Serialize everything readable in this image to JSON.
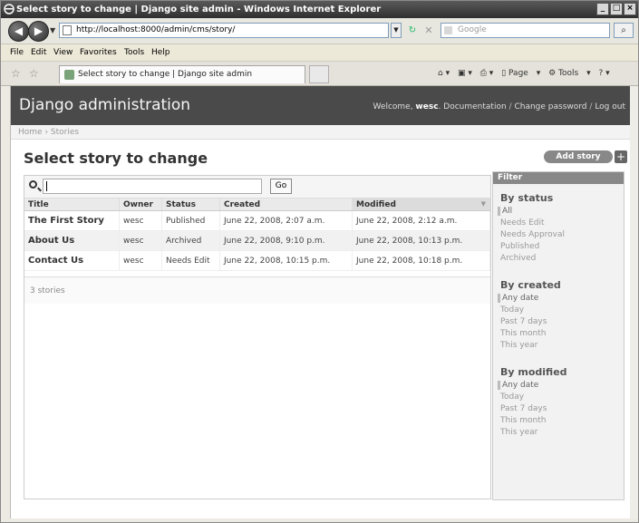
{
  "window": {
    "title": "Select story to change | Django site admin - Windows Internet Explorer"
  },
  "browser": {
    "url": "http://localhost:8000/admin/cms/story/",
    "search_placeholder": "Google",
    "menu": [
      "File",
      "Edit",
      "View",
      "Favorites",
      "Tools",
      "Help"
    ],
    "tab_title": "Select story to change | Django site admin",
    "command_items": [
      "Page",
      "Tools"
    ]
  },
  "django": {
    "site_title": "Django administration",
    "welcome_prefix": "Welcome, ",
    "username": "wesc",
    "links": [
      "Documentation",
      "Change password",
      "Log out"
    ],
    "breadcrumbs": "Home › Stories",
    "page_title": "Select story to change",
    "add_button": "Add story",
    "search_button": "Go",
    "columns": [
      "Title",
      "Owner",
      "Status",
      "Created",
      "Modified"
    ],
    "rows": [
      {
        "title": "The First Story",
        "owner": "wesc",
        "status": "Published",
        "created": "June 22, 2008, 2:07 a.m.",
        "modified": "June 22, 2008, 2:12 a.m."
      },
      {
        "title": "About Us",
        "owner": "wesc",
        "status": "Archived",
        "created": "June 22, 2008, 9:10 p.m.",
        "modified": "June 22, 2008, 10:13 p.m."
      },
      {
        "title": "Contact Us",
        "owner": "wesc",
        "status": "Needs Edit",
        "created": "June 22, 2008, 10:15 p.m.",
        "modified": "June 22, 2008, 10:18 p.m."
      }
    ],
    "result_count": "3 stories",
    "filter": {
      "heading": "Filter",
      "groups": [
        {
          "title": "By status",
          "options": [
            "All",
            "Needs Edit",
            "Needs Approval",
            "Published",
            "Archived"
          ]
        },
        {
          "title": "By created",
          "options": [
            "Any date",
            "Today",
            "Past 7 days",
            "This month",
            "This year"
          ]
        },
        {
          "title": "By modified",
          "options": [
            "Any date",
            "Today",
            "Past 7 days",
            "This month",
            "This year"
          ]
        }
      ]
    }
  }
}
